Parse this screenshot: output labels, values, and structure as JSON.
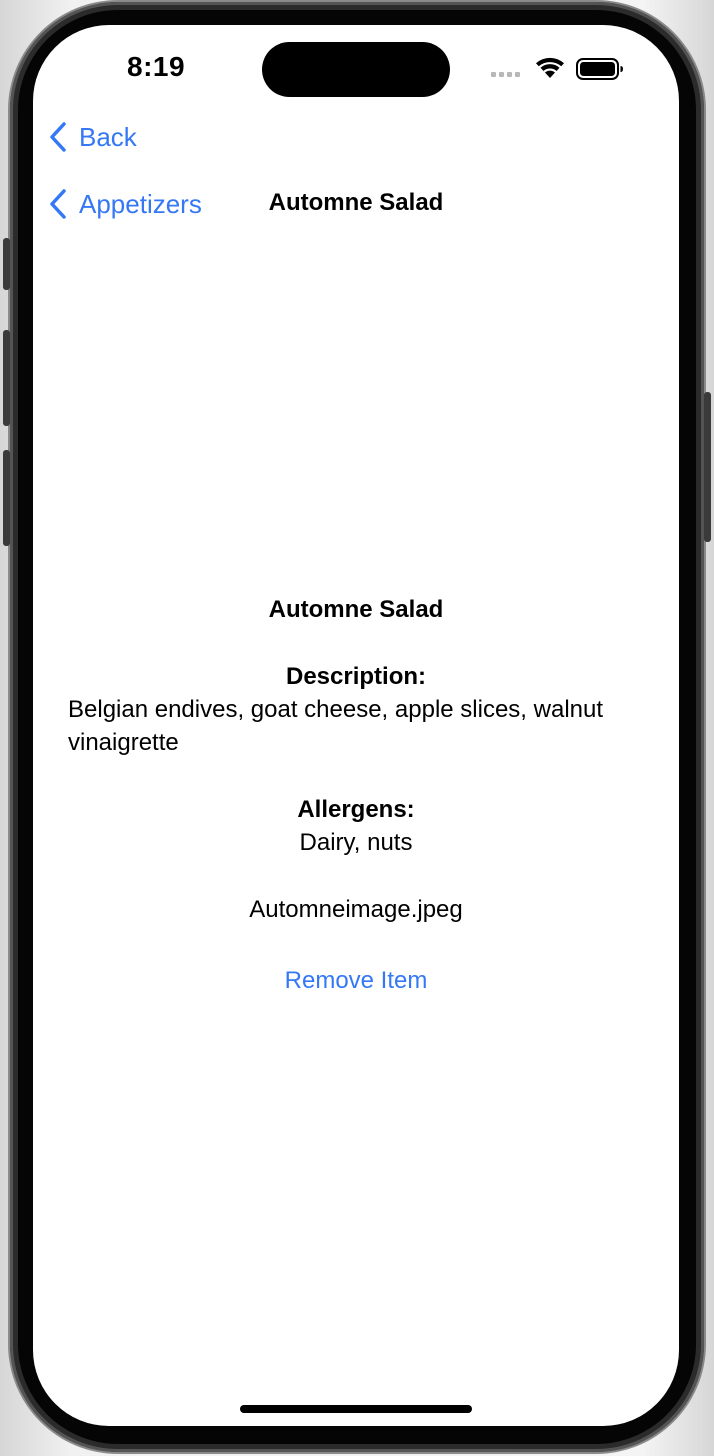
{
  "status_bar": {
    "time": "8:19"
  },
  "nav": {
    "back_label": "Back",
    "parent_label": "Appetizers",
    "title": "Automne Salad"
  },
  "item": {
    "name": "Automne Salad",
    "description_label": "Description:",
    "description": "Belgian endives, goat cheese, apple slices, walnut vinaigrette",
    "allergens_label": "Allergens:",
    "allergens": "Dairy, nuts",
    "image_file": "Automneimage.jpeg",
    "remove_label": "Remove Item"
  },
  "colors": {
    "accent": "#3478f6",
    "text": "#000000",
    "background": "#ffffff"
  }
}
